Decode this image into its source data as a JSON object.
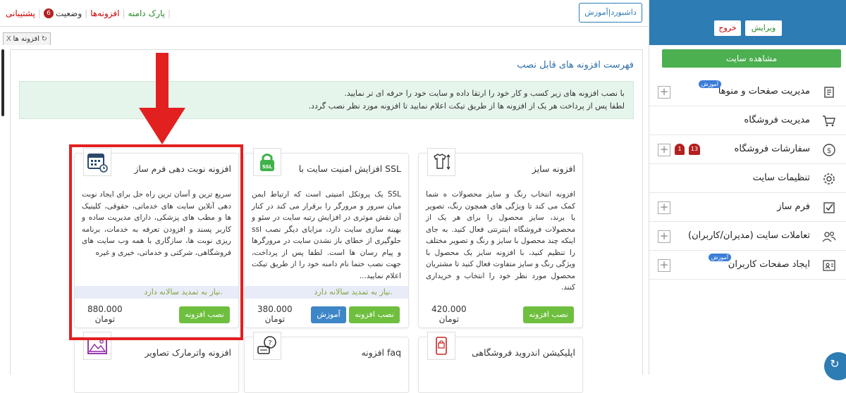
{
  "topbar": {
    "nav": [
      {
        "label": "پشتیبانی",
        "color": "#cc0000"
      },
      {
        "label": "وضعیت",
        "badge": "6",
        "color": "#222222"
      },
      {
        "label": "افزونه‌ها",
        "color": "#cc0000"
      },
      {
        "label": "پارک دامنه",
        "color": "#2a8a2a"
      }
    ],
    "dashboard_button": "داشبورد|آموزش"
  },
  "tabstrip": {
    "close": "X",
    "tab_label": "افزونه ها"
  },
  "main": {
    "heading": "فهرست افزونه های قابل نصب",
    "info_line1": "با نصب افزونه های زیر کسب و کار خود را ارتقا داده و سایت خود را حرفه ای تر نمایید.",
    "info_line2": "لطفا پس از پرداخت هر یک از افزونه ها از طریق تیکت اعلام نمایید تا افزونه مورد نظر نصب گردد.",
    "cards": [
      {
        "title": "افزونه سایز",
        "icon": "tshirt-size-icon",
        "description": "افزونه انتخاب رنگ و سایز محصولات ه شما کمک می کند تا ویژگی های همچون رنگ، تصویر یا برند، سایز محصول را برای هر یک از محصولات فروشگاه اینترنتی فعال کنید. به جای اینکه چند محصول با سایز و رنگ و تصویر مختلف را تنظیم کنید، با افزونه سایز یک محصول با ویژگی رنگ و سایز متفاوت فعال کنید تا مشتریان محصول مورد نظر خود را انتخاب و خریداری کنند.",
        "note": "",
        "price": "420.000",
        "currency": "تومان",
        "install": "نصب افزونه",
        "tutorial": ""
      },
      {
        "title": "افزایش امنیت سایت با SSL",
        "icon": "ssl-lock-icon",
        "description": "SSL یک پروتکل امنیتی است که ارتباط ایمن میان سرور و مرورگر را برقرار می کند در کنار آن نقش موثری در افزایش رتبه سایت در سئو و بهینه سازی سایت دارد، مزایای دیگر نصب ssl جلوگیری از خطای باز نشدن سایت در مرورگرها و پیام رسان ها است. لطفا پس از پرداخت، جهت نصب حتما نام دامنه خود را از طریق تیکت اعلام نمایید...",
        "note": "نیاز به تمدید سالانه دارد.",
        "price": "380.000",
        "currency": "تومان",
        "install": "نصب افزونه",
        "tutorial": "آموزش"
      },
      {
        "title": "افزونه نوبت دهی فرم ساز",
        "icon": "calendar-icon",
        "description": "سریع ترین و آسان ترین راه حل برای ایجاد نوبت دهی آنلاین سایت های خدماتی، حقوقی، کلینیک ها و مطب های پزشکی، دارای مدیریت ساده و کاربر پسند و افزودن تعرفه به خدمات، برنامه ریزی نوبت ها، سازگاری با همه وب سایت های فروشگاهی، شرکتی و خدماتی، خیری و غیره",
        "note": "نیاز به تمدید سالانه دارد.",
        "price": "880.000",
        "currency": "تومان",
        "install": "نصب افزونه",
        "tutorial": ""
      }
    ],
    "cards_row2": [
      {
        "title": "اپلیکیشن اندروید فروشگاهی",
        "icon": "android-app-icon"
      },
      {
        "title": "افزونه faq",
        "icon": "faq-chat-icon"
      },
      {
        "title": "افزونه واترمارک تصاویر",
        "icon": "watermark-image-icon"
      }
    ]
  },
  "sidebar": {
    "edit_button": "ویرایش",
    "logout_button": "خروج",
    "view_site_button": "مشاهده سایت",
    "menu": [
      {
        "label": "مدیریت صفحات و منوها",
        "icon": "pages-icon",
        "badge": "آموزش",
        "bells": []
      },
      {
        "label": "مدیریت فروشگاه",
        "icon": "cart-icon",
        "badge": "",
        "bells": []
      },
      {
        "label": "سفارشات فروشگاه",
        "icon": "dollar-icon",
        "badge": "",
        "bells": [
          "13",
          "1"
        ]
      },
      {
        "label": "تنظیمات سایت",
        "icon": "gear-icon",
        "badge": "",
        "bells": []
      },
      {
        "label": "فرم ساز",
        "icon": "checkbox-icon",
        "badge": "",
        "bells": []
      },
      {
        "label": "تعاملات سایت (مدیران/کاربران)",
        "icon": "users-icon",
        "badge": "",
        "bells": []
      },
      {
        "label": "ایجاد صفحات کاربران",
        "icon": "user-page-icon",
        "badge": "آموزش",
        "bells": []
      }
    ]
  },
  "colors": {
    "accent_blue": "#2d7cb4",
    "green": "#6fbf3f",
    "highlight_red": "#e32020"
  }
}
